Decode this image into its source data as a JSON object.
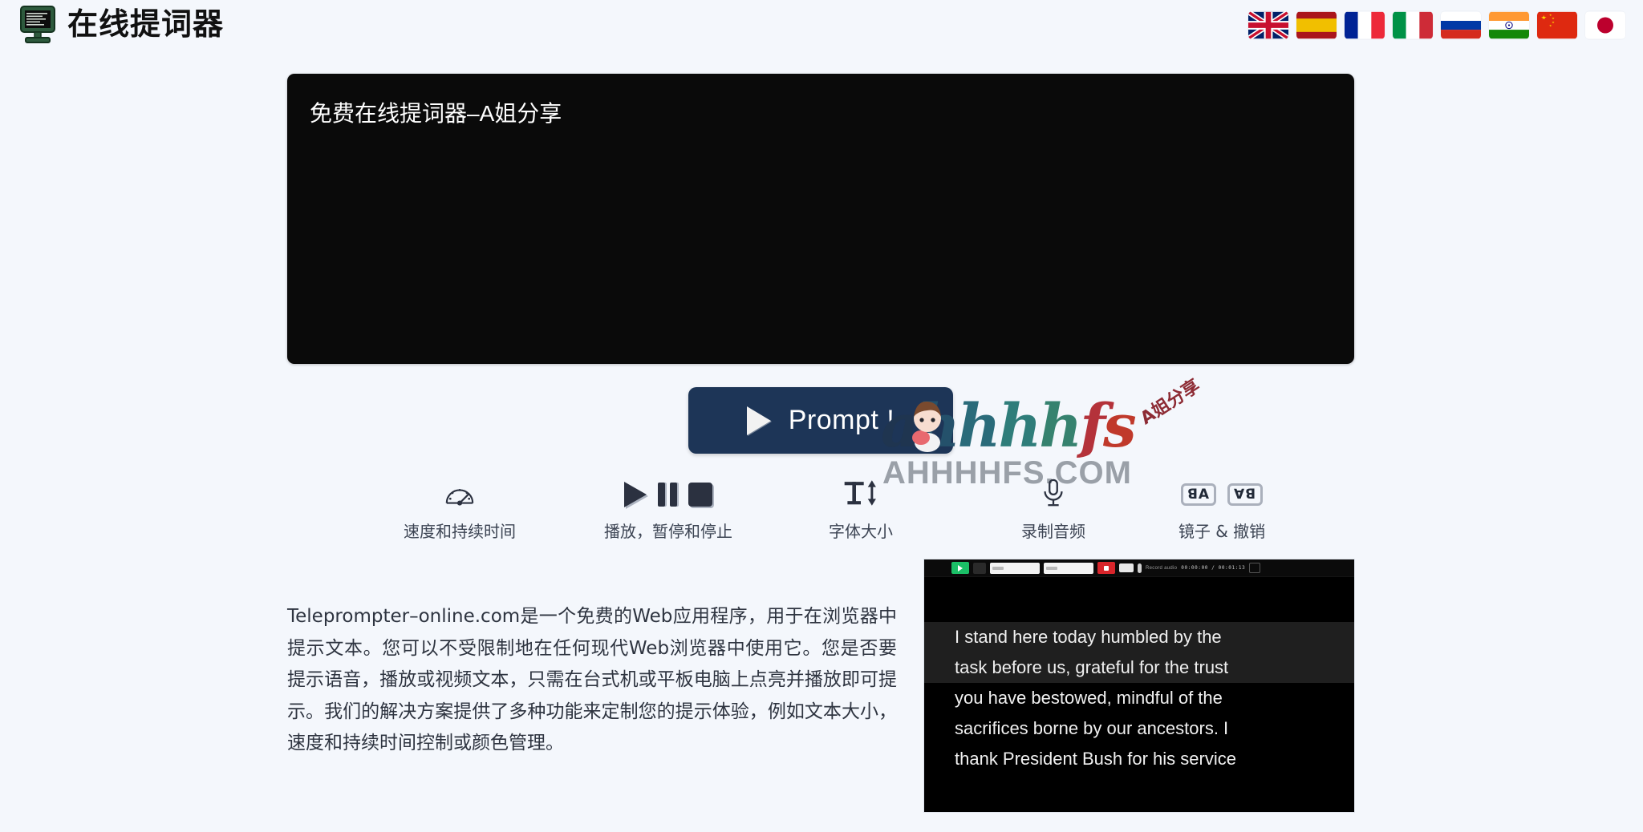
{
  "header": {
    "title": "在线提词器",
    "logo_icon": "crt-monitor-icon",
    "flags": [
      {
        "code": "gb",
        "label": "English"
      },
      {
        "code": "es",
        "label": "Español"
      },
      {
        "code": "fr",
        "label": "Français"
      },
      {
        "code": "it",
        "label": "Italiano"
      },
      {
        "code": "ru",
        "label": "Русский"
      },
      {
        "code": "in",
        "label": "हिन्दी"
      },
      {
        "code": "cn",
        "label": "中文"
      },
      {
        "code": "jp",
        "label": "日本語"
      }
    ]
  },
  "editor": {
    "value": "免费在线提词器–A姐分享",
    "placeholder": "免费在线提词器–A姐分享"
  },
  "prompt_button": {
    "label": "Prompt !",
    "icon": "play-icon",
    "bg_color": "#1d3557"
  },
  "watermark": {
    "logo_letters": [
      "a",
      "h",
      "h",
      "h",
      "h",
      "f",
      "s"
    ],
    "cn_text": "A姐分享",
    "domain": "AHHHHFS.COM"
  },
  "features": [
    {
      "name": "speed-duration",
      "label": "速度和持续时间",
      "icons": [
        "gauge-icon"
      ]
    },
    {
      "name": "playback",
      "label": "播放，暂停和停止",
      "icons": [
        "play-icon",
        "pause-icon",
        "stop-icon"
      ]
    },
    {
      "name": "font-size",
      "label": "字体大小",
      "icons": [
        "text-size-icon"
      ]
    },
    {
      "name": "record-audio",
      "label": "录制音频",
      "icons": [
        "microphone-icon"
      ]
    },
    {
      "name": "mirror-undo",
      "label": "镜子 & 撤销",
      "icons": [
        "mirror-horizontal-icon",
        "mirror-vertical-icon"
      ],
      "mirror_h_text": "ꓭA",
      "mirror_v_text": "∀ꓭ"
    }
  ],
  "description": "Teleprompter–online.com是一个免费的Web应用程序，用于在浏览器中提示文本。您可以不受限制地在任何现代Web浏览器中使用它。您是否要提示语音，播放或视频文本，只需在台式机或平板电脑上点亮并播放即可提示。我们的解决方案提供了多种功能来定制您的提示体验，例如文本大小，速度和持续时间控制或颜色管理。",
  "video_preview": {
    "toolbar": {
      "status_text": "Record audio",
      "timecode": "00:00:00 / 00:01:13"
    },
    "lines": [
      "I stand here today humbled by the",
      "task before us, grateful for the trust",
      "you have bestowed, mindful of the",
      "sacrifices borne by our ancestors. I",
      "thank President Bush for his service"
    ]
  },
  "colors": {
    "page_bg": "#f4f7fc",
    "editor_bg": "#0a0a0a",
    "accent": "#1d3557",
    "text": "#2e3440",
    "icon": "#2b3140"
  }
}
